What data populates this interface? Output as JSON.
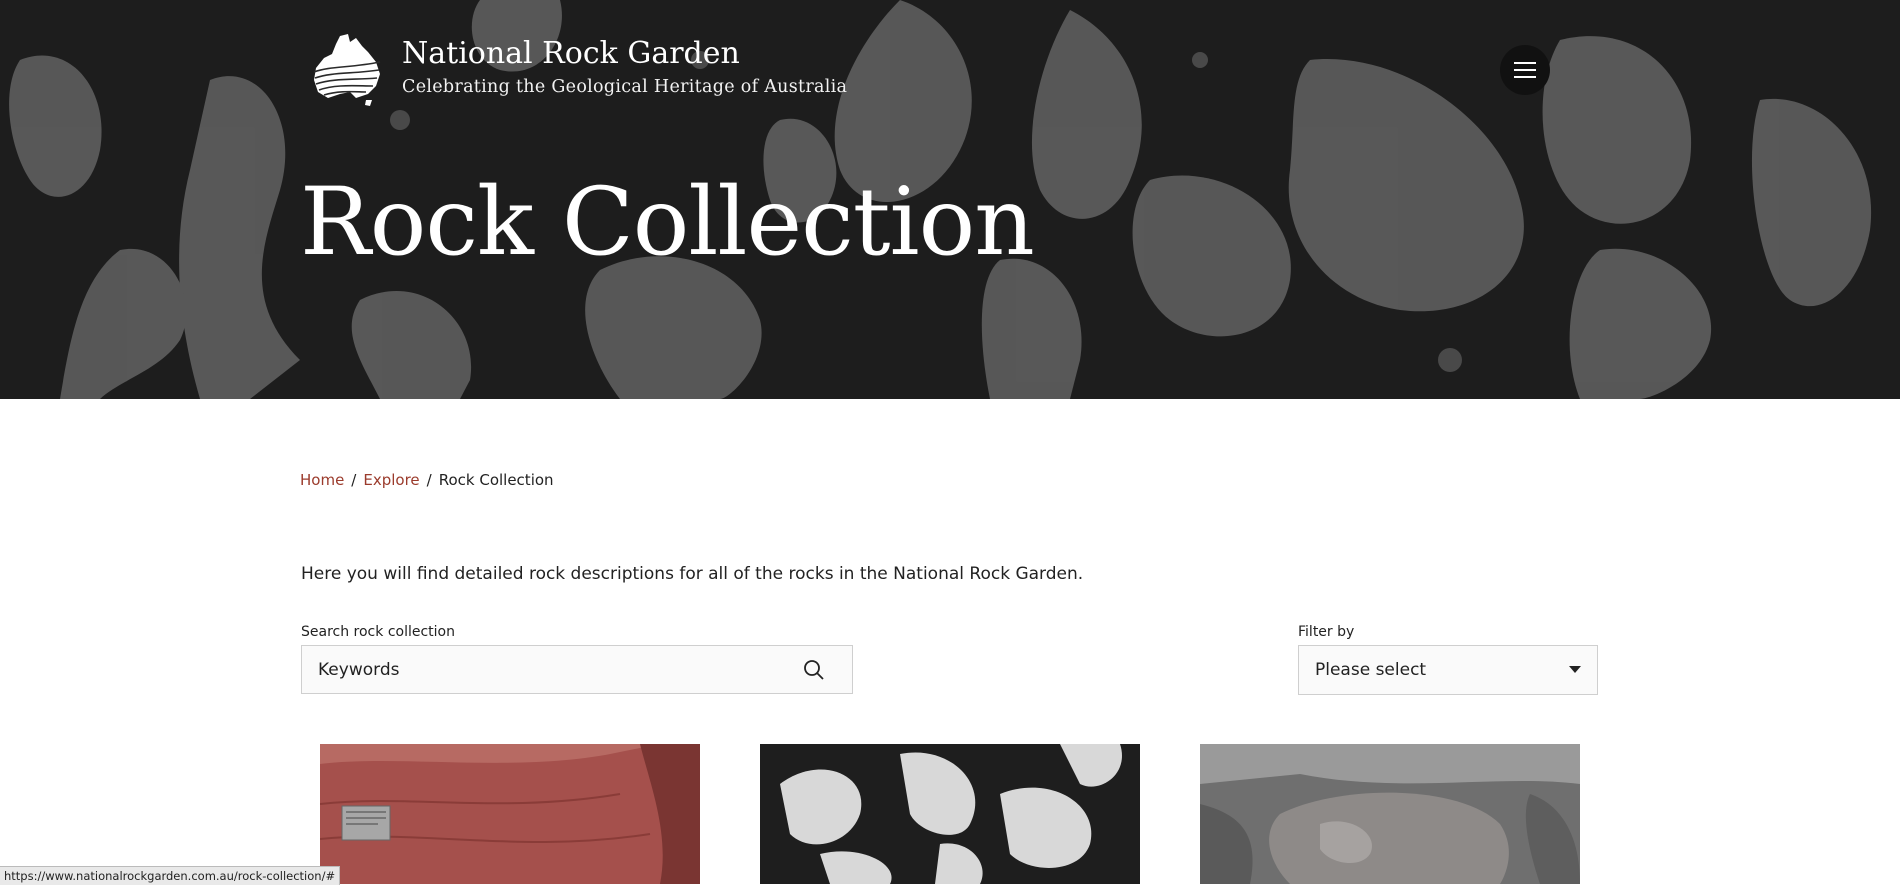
{
  "header": {
    "site_title": "National Rock Garden",
    "tagline": "Celebrating the Geological Heritage of Australia"
  },
  "hero": {
    "title": "Rock Collection"
  },
  "breadcrumb": {
    "home": "Home",
    "explore": "Explore",
    "current": "Rock Collection",
    "separator": "/"
  },
  "intro_text": "Here you will find detailed rock descriptions for all of the rocks in the National Rock Garden.",
  "search": {
    "label": "Search rock collection",
    "placeholder": "Keywords",
    "icon": "search-icon"
  },
  "filter": {
    "label": "Filter by",
    "selected": "Please select",
    "icon": "caret-down-icon"
  },
  "status_bar": {
    "url": "https://www.nationalrockgarden.com.au/rock-collection/#"
  },
  "colors": {
    "link": "#9b3b2c",
    "hero_bg": "#2a2a2a",
    "red_rock": "#a5504c"
  }
}
